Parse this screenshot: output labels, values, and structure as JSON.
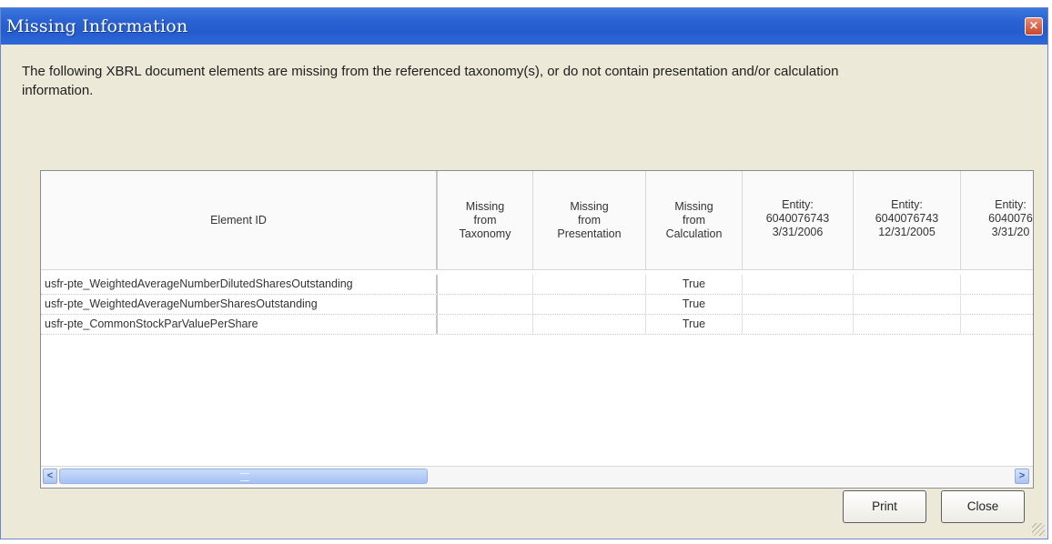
{
  "window": {
    "title": "Missing Information",
    "close_glyph": "×"
  },
  "message": "The following XBRL document elements are missing from the referenced taxonomy(s), or do not contain presentation and/or calculation information.",
  "table": {
    "headers": [
      "Element ID",
      "Missing\nfrom\nTaxonomy",
      "Missing\nfrom\nPresentation",
      "Missing\nfrom\nCalculation",
      "Entity:\n6040076743\n3/31/2006",
      "Entity:\n6040076743\n12/31/2005",
      "Entity:\n6040076\n3/31/20"
    ],
    "rows": [
      [
        "usfr-pte_WeightedAverageNumberDilutedSharesOutstanding",
        "",
        "",
        "True",
        "",
        "",
        ""
      ],
      [
        "usfr-pte_WeightedAverageNumberSharesOutstanding",
        "",
        "",
        "True",
        "",
        "",
        ""
      ],
      [
        "usfr-pte_CommonStockParValuePerShare",
        "",
        "",
        "True",
        "",
        "",
        ""
      ]
    ]
  },
  "scrollbar": {
    "left_glyph": "<",
    "right_glyph": ">"
  },
  "buttons": {
    "print": "Print",
    "close": "Close"
  },
  "icons": {
    "close": "close-icon",
    "scroll_left": "chevron-left-icon",
    "scroll_right": "chevron-right-icon",
    "resize": "resize-grip-icon"
  },
  "colors": {
    "titlebar": "#2b62d2",
    "dialog_bg": "#ECE9D8",
    "close_button": "#c8462a"
  }
}
